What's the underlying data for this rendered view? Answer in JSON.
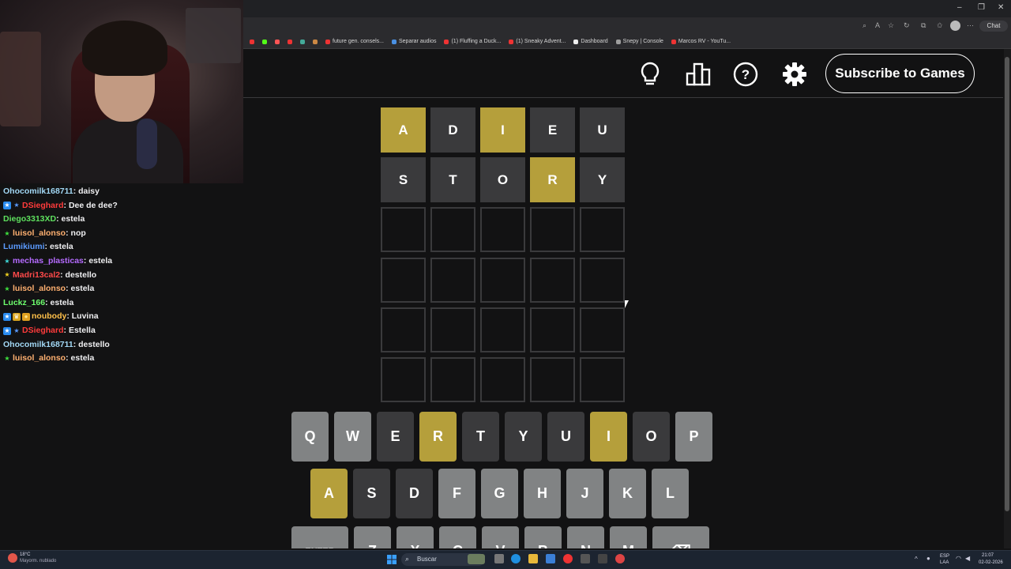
{
  "browser": {
    "bookmarks": [
      "future gen. consels...",
      "Separar audios",
      "(1) Fluffing a Duck...",
      "(1) Sneaky Advent...",
      "Dashboard",
      "Snepy | Console",
      "Marcos RV - YouTu..."
    ],
    "chat_button": "Chat"
  },
  "game": {
    "subscribe_label": "Subscribe to Games",
    "header_icons": [
      "lightbulb-icon",
      "leaderboard-icon",
      "help-icon",
      "settings-icon"
    ],
    "board": [
      [
        {
          "l": "A",
          "s": "present"
        },
        {
          "l": "D",
          "s": "absent"
        },
        {
          "l": "I",
          "s": "present"
        },
        {
          "l": "E",
          "s": "absent"
        },
        {
          "l": "U",
          "s": "absent"
        }
      ],
      [
        {
          "l": "S",
          "s": "absent"
        },
        {
          "l": "T",
          "s": "absent"
        },
        {
          "l": "O",
          "s": "absent"
        },
        {
          "l": "R",
          "s": "present"
        },
        {
          "l": "Y",
          "s": "absent"
        }
      ],
      [
        {
          "l": "",
          "s": "empty"
        },
        {
          "l": "",
          "s": "empty"
        },
        {
          "l": "",
          "s": "empty"
        },
        {
          "l": "",
          "s": "empty"
        },
        {
          "l": "",
          "s": "empty"
        }
      ],
      [
        {
          "l": "",
          "s": "empty"
        },
        {
          "l": "",
          "s": "empty"
        },
        {
          "l": "",
          "s": "empty"
        },
        {
          "l": "",
          "s": "empty"
        },
        {
          "l": "",
          "s": "empty"
        }
      ],
      [
        {
          "l": "",
          "s": "empty"
        },
        {
          "l": "",
          "s": "empty"
        },
        {
          "l": "",
          "s": "empty"
        },
        {
          "l": "",
          "s": "empty"
        },
        {
          "l": "",
          "s": "empty"
        }
      ],
      [
        {
          "l": "",
          "s": "empty"
        },
        {
          "l": "",
          "s": "empty"
        },
        {
          "l": "",
          "s": "empty"
        },
        {
          "l": "",
          "s": "empty"
        },
        {
          "l": "",
          "s": "empty"
        }
      ]
    ],
    "keyboard": {
      "row1": [
        {
          "k": "Q",
          "s": "unused"
        },
        {
          "k": "W",
          "s": "unused"
        },
        {
          "k": "E",
          "s": "absent"
        },
        {
          "k": "R",
          "s": "present"
        },
        {
          "k": "T",
          "s": "absent"
        },
        {
          "k": "Y",
          "s": "absent"
        },
        {
          "k": "U",
          "s": "absent"
        },
        {
          "k": "I",
          "s": "present"
        },
        {
          "k": "O",
          "s": "absent"
        },
        {
          "k": "P",
          "s": "unused"
        }
      ],
      "row2": [
        {
          "k": "A",
          "s": "present"
        },
        {
          "k": "S",
          "s": "absent"
        },
        {
          "k": "D",
          "s": "absent"
        },
        {
          "k": "F",
          "s": "unused"
        },
        {
          "k": "G",
          "s": "unused"
        },
        {
          "k": "H",
          "s": "unused"
        },
        {
          "k": "J",
          "s": "unused"
        },
        {
          "k": "K",
          "s": "unused"
        },
        {
          "k": "L",
          "s": "unused"
        }
      ],
      "row3": [
        {
          "k": "ENTER",
          "s": "unused"
        },
        {
          "k": "Z",
          "s": "unused"
        },
        {
          "k": "X",
          "s": "unused"
        },
        {
          "k": "C",
          "s": "unused"
        },
        {
          "k": "V",
          "s": "unused"
        },
        {
          "k": "B",
          "s": "unused"
        },
        {
          "k": "N",
          "s": "unused"
        },
        {
          "k": "M",
          "s": "unused"
        },
        {
          "k": "⌫",
          "s": "unused"
        }
      ]
    },
    "colors": {
      "present": "#b59f3b",
      "absent": "#3a3a3c",
      "correct": "#538d4e",
      "unused": "#818384"
    }
  },
  "chat": [
    {
      "badges": [],
      "user": "Ohocomilk168711",
      "color": "#a2d8f5",
      "text": "daisy"
    },
    {
      "badges": [
        "prime",
        "star"
      ],
      "user": "DSieghard",
      "color": "#ff3b3b",
      "text": "Dee de dee?"
    },
    {
      "badges": [],
      "user": "Diego3313XD",
      "color": "#5ee05e",
      "text": "estela"
    },
    {
      "badges": [
        "star-green"
      ],
      "user": "luisol_alonso",
      "color": "#ffb070",
      "text": "nop"
    },
    {
      "badges": [],
      "user": "Lumikiumi",
      "color": "#5b9bff",
      "text": "estela"
    },
    {
      "badges": [
        "star-cyan"
      ],
      "user": "mechas_plasticas",
      "color": "#b56bff",
      "text": "estela"
    },
    {
      "badges": [
        "star-yellow"
      ],
      "user": "Madri13cal2",
      "color": "#ff4a4a",
      "text": "destello"
    },
    {
      "badges": [
        "star-green"
      ],
      "user": "luisol_alonso",
      "color": "#ffb070",
      "text": "estela"
    },
    {
      "badges": [],
      "user": "Luckz_166",
      "color": "#6eff6e",
      "text": "estela"
    },
    {
      "badges": [
        "prime",
        "crown",
        "coin"
      ],
      "user": "noubody",
      "color": "#ffc04a",
      "text": "Luvina"
    },
    {
      "badges": [
        "prime",
        "star"
      ],
      "user": "DSieghard",
      "color": "#ff3b3b",
      "text": "Estella"
    },
    {
      "badges": [],
      "user": "Ohocomilk168711",
      "color": "#a2d8f5",
      "text": "destello"
    },
    {
      "badges": [
        "star-green"
      ],
      "user": "luisol_alonso",
      "color": "#ffb070",
      "text": "estela"
    }
  ],
  "taskbar": {
    "search_placeholder": "Buscar",
    "weather_temp": "18°C",
    "weather_desc": "Mayorm. nublado",
    "lang": "ESP",
    "lang2": "LAA",
    "time": "21:07",
    "date": "02-02-2026"
  }
}
